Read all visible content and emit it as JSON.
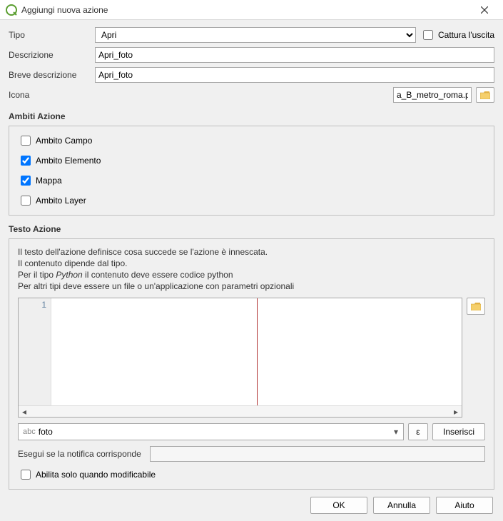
{
  "window": {
    "title": "Aggiungi nuova azione"
  },
  "form": {
    "tipo_label": "Tipo",
    "tipo_value": "Apri",
    "capture_label": "Cattura l'uscita",
    "descrizione_label": "Descrizione",
    "descrizione_value": "Apri_foto",
    "breve_label": "Breve descrizione",
    "breve_value": "Apri_foto",
    "icona_label": "Icona",
    "icona_value": "a_B_metro_roma.png"
  },
  "ambiti": {
    "title": "Ambiti Azione",
    "campo": "Ambito Campo",
    "elemento": "Ambito Elemento",
    "mappa": "Mappa",
    "layer": "Ambito Layer",
    "checked": {
      "campo": false,
      "elemento": true,
      "mappa": true,
      "layer": false
    }
  },
  "testo": {
    "title": "Testo Azione",
    "line1": "Il testo dell'azione definisce cosa succede se l'azione è innescata.",
    "line2": "Il contenuto dipende dal tipo.",
    "line3a": "Per il tipo ",
    "line3b": "Python",
    "line3c": " il contenuto deve essere codice python",
    "line4": "Per altri tipi deve essere un file o un'applicazione con parametri opzionali",
    "line_number": "1",
    "field_prefix": "abc",
    "field_value": "foto",
    "expr_btn": "ε",
    "insert_btn": "Inserisci",
    "notify_label": "Esegui se la notifica corrisponde",
    "notify_value": "",
    "enable_editable": "Abilita solo quando modificabile"
  },
  "buttons": {
    "ok": "OK",
    "cancel": "Annulla",
    "help": "Aiuto"
  }
}
